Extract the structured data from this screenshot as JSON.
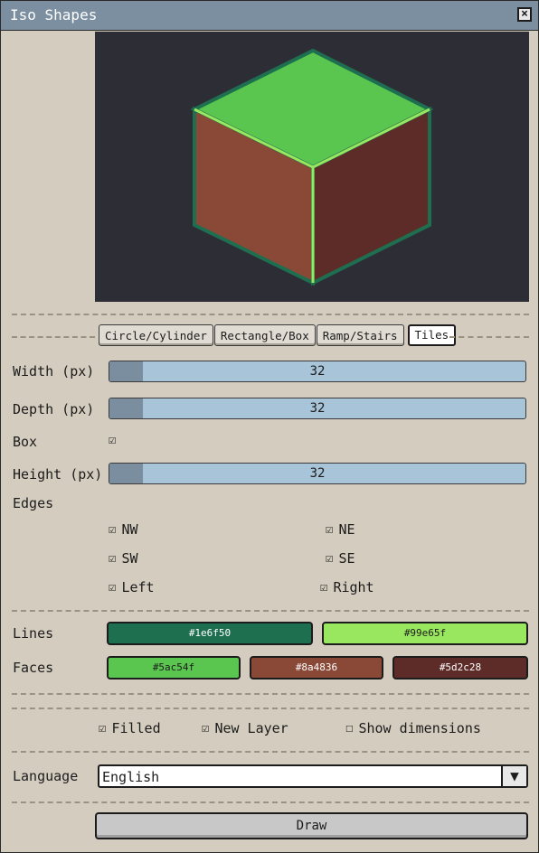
{
  "window": {
    "title": "Iso Shapes"
  },
  "colors": {
    "preview_bg": "#2d2d35",
    "top_face": "#5ac54f",
    "left_face": "#8a4836",
    "right_face": "#5d2c28",
    "line_dark": "#1e6f50",
    "line_light": "#99e65f"
  },
  "tabs": [
    {
      "label": "Circle/Cylinder"
    },
    {
      "label": "Rectangle/Box"
    },
    {
      "label": "Ramp/Stairs"
    },
    {
      "label": "Tiles"
    }
  ],
  "width": {
    "label": "Width (px)",
    "value": "32",
    "level": 0.08
  },
  "depth": {
    "label": "Depth (px)",
    "value": "32",
    "level": 0.08
  },
  "box": {
    "label": "Box",
    "checked": true
  },
  "height": {
    "label": "Height (px)",
    "value": "32",
    "level": 0.08
  },
  "edges": {
    "label": "Edges",
    "nw": "NW",
    "ne": "NE",
    "sw": "SW",
    "se": "SE",
    "left": "Left",
    "right": "Right"
  },
  "lines": {
    "label": "Lines",
    "c1": {
      "hex": "#1e6f50",
      "text": "#1e6f50"
    },
    "c2": {
      "hex": "#99e65f",
      "text": "#99e65f"
    }
  },
  "faces": {
    "label": "Faces",
    "c1": {
      "hex": "#5ac54f",
      "text": "#5ac54f"
    },
    "c2": {
      "hex": "#8a4836",
      "text": "#8a4836"
    },
    "c3": {
      "hex": "#5d2c28",
      "text": "#5d2c28"
    }
  },
  "options": {
    "filled": "Filled",
    "new_layer": "New Layer",
    "show_dimensions": "Show dimensions"
  },
  "language": {
    "label": "Language",
    "value": "English"
  },
  "draw": {
    "label": "Draw"
  }
}
